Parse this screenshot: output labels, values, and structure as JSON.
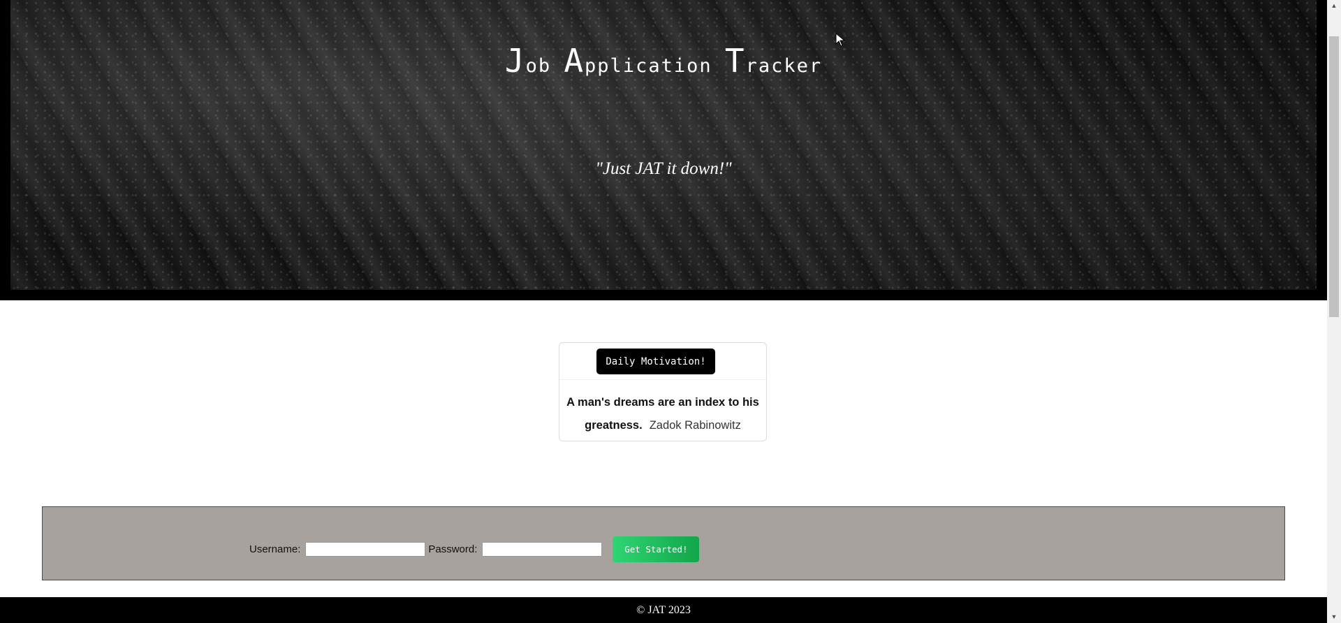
{
  "hero": {
    "title_parts": [
      {
        "cap": "J",
        "rest": "ob"
      },
      {
        "cap": "A",
        "rest": "pplication"
      },
      {
        "cap": "T",
        "rest": "racker"
      }
    ],
    "tagline": "\"Just JAT it down!\""
  },
  "motivation": {
    "button_label": "Daily Motivation!",
    "quote": "A man's dreams are an index to his greatness.",
    "author": "Zadok Rabinowitz"
  },
  "login": {
    "username_label": "Username:",
    "username_value": "",
    "password_label": "Password:",
    "password_value": "",
    "submit_label": "Get Started!"
  },
  "footer": {
    "text": "© JAT 2023"
  },
  "colors": {
    "panel_bg": "#a8a29e",
    "button_gradient_start": "#2ed573",
    "button_gradient_end": "#12a64a",
    "hero_bg": "#141414"
  },
  "icons": {
    "scroll_up": "triangle-up-icon",
    "scroll_down": "triangle-down-icon",
    "cursor": "mouse-pointer-icon"
  }
}
